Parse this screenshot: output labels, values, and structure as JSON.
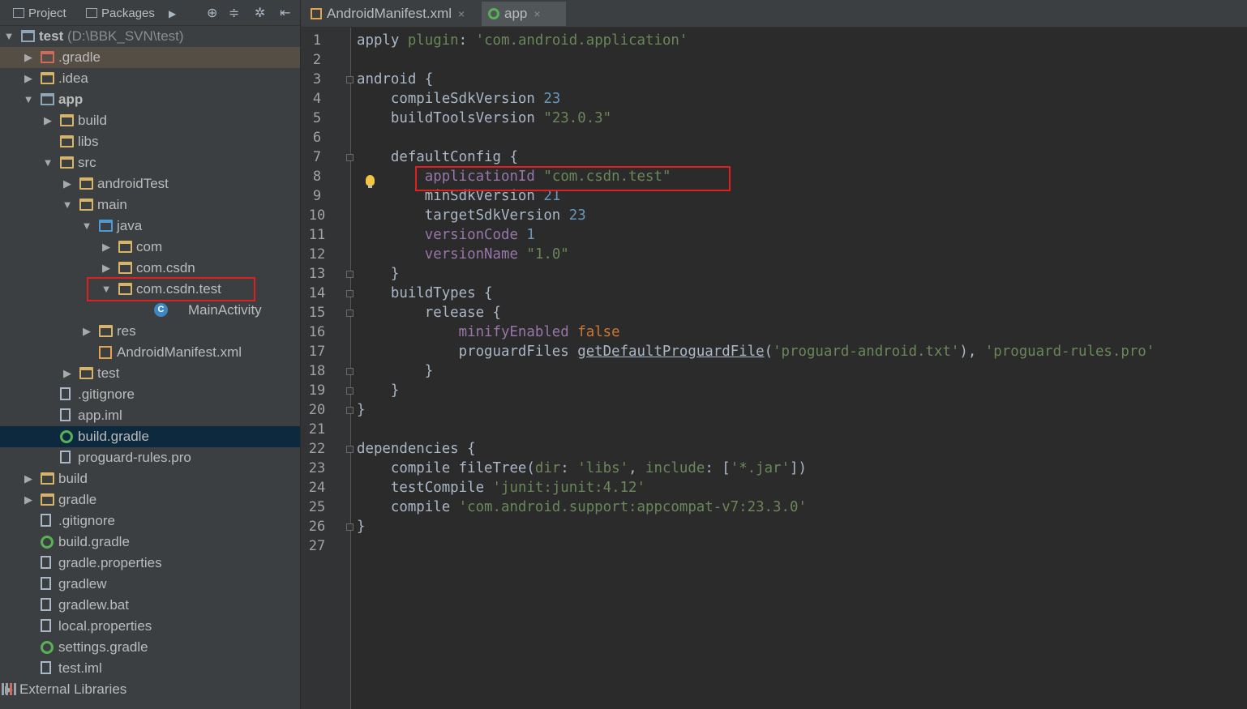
{
  "left_toolbar": {
    "project_label": "Project",
    "packages_label": "Packages",
    "more_glyph": "▶",
    "locate_glyph": "⊕",
    "collapse_glyph": "≑",
    "settings_glyph": "✲",
    "hide_glyph": "⇤"
  },
  "tree": [
    {
      "depth": 0,
      "arrow": "▼",
      "icon": "module",
      "label": "test",
      "extra": " (D:\\BBK_SVN\\test)",
      "bold": true
    },
    {
      "depth": 1,
      "arrow": "▶",
      "icon": "folder-excluded",
      "label": ".gradle",
      "highlight": true
    },
    {
      "depth": 1,
      "arrow": "▶",
      "icon": "folder",
      "label": ".idea"
    },
    {
      "depth": 1,
      "arrow": "▼",
      "icon": "module",
      "label": "app",
      "bold": true
    },
    {
      "depth": 2,
      "arrow": "▶",
      "icon": "folder",
      "label": "build"
    },
    {
      "depth": 2,
      "arrow": "",
      "icon": "folder",
      "label": "libs"
    },
    {
      "depth": 2,
      "arrow": "▼",
      "icon": "folder",
      "label": "src"
    },
    {
      "depth": 3,
      "arrow": "▶",
      "icon": "folder",
      "label": "androidTest"
    },
    {
      "depth": 3,
      "arrow": "▼",
      "icon": "folder",
      "label": "main"
    },
    {
      "depth": 4,
      "arrow": "▼",
      "icon": "folder-src",
      "label": "java"
    },
    {
      "depth": 5,
      "arrow": "▶",
      "icon": "folder",
      "label": "com"
    },
    {
      "depth": 5,
      "arrow": "▶",
      "icon": "folder",
      "label": "com.csdn"
    },
    {
      "depth": 5,
      "arrow": "▼",
      "icon": "folder",
      "label": "com.csdn.test"
    },
    {
      "depth": 6,
      "arrow": "",
      "icon": "class",
      "label": "MainActivity",
      "offset": 20
    },
    {
      "depth": 4,
      "arrow": "▶",
      "icon": "folder-res",
      "label": "res"
    },
    {
      "depth": 4,
      "arrow": "",
      "icon": "xml",
      "label": "AndroidManifest.xml"
    },
    {
      "depth": 3,
      "arrow": "▶",
      "icon": "folder",
      "label": "test"
    },
    {
      "depth": 3,
      "arrow": "",
      "icon": "file",
      "label": ".gitignore",
      "shift": -24
    },
    {
      "depth": 3,
      "arrow": "",
      "icon": "file",
      "label": "app.iml",
      "shift": -24
    },
    {
      "depth": 3,
      "arrow": "",
      "icon": "gradle",
      "label": "build.gradle",
      "shift": -24,
      "selected": true
    },
    {
      "depth": 3,
      "arrow": "",
      "icon": "file",
      "label": "proguard-rules.pro",
      "shift": -24
    },
    {
      "depth": 1,
      "arrow": "▶",
      "icon": "folder",
      "label": "build"
    },
    {
      "depth": 1,
      "arrow": "▶",
      "icon": "folder",
      "label": "gradle"
    },
    {
      "depth": 1,
      "arrow": "",
      "icon": "file",
      "label": ".gitignore"
    },
    {
      "depth": 1,
      "arrow": "",
      "icon": "gradle",
      "label": "build.gradle"
    },
    {
      "depth": 1,
      "arrow": "",
      "icon": "file",
      "label": "gradle.properties"
    },
    {
      "depth": 1,
      "arrow": "",
      "icon": "file",
      "label": "gradlew"
    },
    {
      "depth": 1,
      "arrow": "",
      "icon": "file",
      "label": "gradlew.bat"
    },
    {
      "depth": 1,
      "arrow": "",
      "icon": "file",
      "label": "local.properties"
    },
    {
      "depth": 1,
      "arrow": "",
      "icon": "gradle",
      "label": "settings.gradle"
    },
    {
      "depth": 1,
      "arrow": "",
      "icon": "file",
      "label": "test.iml"
    },
    {
      "depth": 0,
      "arrow": "▶",
      "icon": "lib",
      "label": "External Libraries",
      "shift": -24
    }
  ],
  "editor_tabs": [
    {
      "label": "AndroidManifest.xml",
      "close": "×",
      "active": false,
      "icon": "xml"
    },
    {
      "label": "app",
      "close": "×",
      "active": true,
      "icon": "gradle"
    }
  ],
  "code_lines": [
    [
      [
        "apply ",
        "param"
      ],
      [
        "plugin",
        "plugin"
      ],
      [
        ": ",
        "param"
      ],
      [
        "'com.android.application'",
        "str"
      ]
    ],
    [],
    [
      [
        "android {",
        "param"
      ]
    ],
    [
      [
        "    compileSdkVersion ",
        "param"
      ],
      [
        "23",
        "num"
      ]
    ],
    [
      [
        "    buildToolsVersion ",
        "param"
      ],
      [
        "\"23.0.3\"",
        "str"
      ]
    ],
    [],
    [
      [
        "    defaultConfig {",
        "param"
      ]
    ],
    [
      [
        "        ",
        "param"
      ],
      [
        "applicationId",
        "prop"
      ],
      [
        " ",
        "param"
      ],
      [
        "\"com.csdn.test\"",
        "str"
      ]
    ],
    [
      [
        "        minSdkVersion ",
        "param"
      ],
      [
        "21",
        "num"
      ]
    ],
    [
      [
        "        targetSdkVersion ",
        "param"
      ],
      [
        "23",
        "num"
      ]
    ],
    [
      [
        "        ",
        "param"
      ],
      [
        "versionCode",
        "prop"
      ],
      [
        " ",
        "param"
      ],
      [
        "1",
        "num"
      ]
    ],
    [
      [
        "        ",
        "param"
      ],
      [
        "versionName",
        "prop"
      ],
      [
        " ",
        "param"
      ],
      [
        "\"1.0\"",
        "str"
      ]
    ],
    [
      [
        "    }",
        "param"
      ]
    ],
    [
      [
        "    buildTypes {",
        "param"
      ]
    ],
    [
      [
        "        release {",
        "param"
      ]
    ],
    [
      [
        "            ",
        "param"
      ],
      [
        "minifyEnabled",
        "prop"
      ],
      [
        " ",
        "param"
      ],
      [
        "false",
        "kw"
      ]
    ],
    [
      [
        "            proguardFiles ",
        "param"
      ],
      [
        "getDefaultProguardFile",
        "meth"
      ],
      [
        "(",
        "param"
      ],
      [
        "'proguard-android.txt'",
        "str"
      ],
      [
        "), ",
        "param"
      ],
      [
        "'proguard-rules.pro'",
        "str"
      ]
    ],
    [
      [
        "        }",
        "param"
      ]
    ],
    [
      [
        "    }",
        "param"
      ]
    ],
    [
      [
        "}",
        "param"
      ]
    ],
    [],
    [
      [
        "dependencies {",
        "param"
      ]
    ],
    [
      [
        "    compile fileTree(",
        "param"
      ],
      [
        "dir",
        "plugin"
      ],
      [
        ": ",
        "param"
      ],
      [
        "'libs'",
        "str"
      ],
      [
        ", ",
        "param"
      ],
      [
        "include",
        "plugin"
      ],
      [
        ": [",
        "param"
      ],
      [
        "'*.jar'",
        "str"
      ],
      [
        "])",
        "param"
      ]
    ],
    [
      [
        "    testCompile ",
        "param"
      ],
      [
        "'junit:junit:4.12'",
        "str"
      ]
    ],
    [
      [
        "    compile ",
        "param"
      ],
      [
        "'com.android.support:appcompat-v7:23.3.0'",
        "str"
      ]
    ],
    [
      [
        "}",
        "param"
      ]
    ],
    []
  ],
  "line_numbers": [
    "1",
    "2",
    "3",
    "4",
    "5",
    "6",
    "7",
    "8",
    "9",
    "10",
    "11",
    "12",
    "13",
    "14",
    "15",
    "16",
    "17",
    "18",
    "19",
    "20",
    "21",
    "22",
    "23",
    "24",
    "25",
    "26",
    "27"
  ],
  "colors": {
    "background": "#2b2b2b",
    "panel": "#3c3f41",
    "selection": "#0d293e",
    "highlight_box": "#e0201d",
    "string": "#6a8759",
    "number": "#6897bb",
    "property": "#9876aa",
    "keyword": "#cc7832"
  }
}
